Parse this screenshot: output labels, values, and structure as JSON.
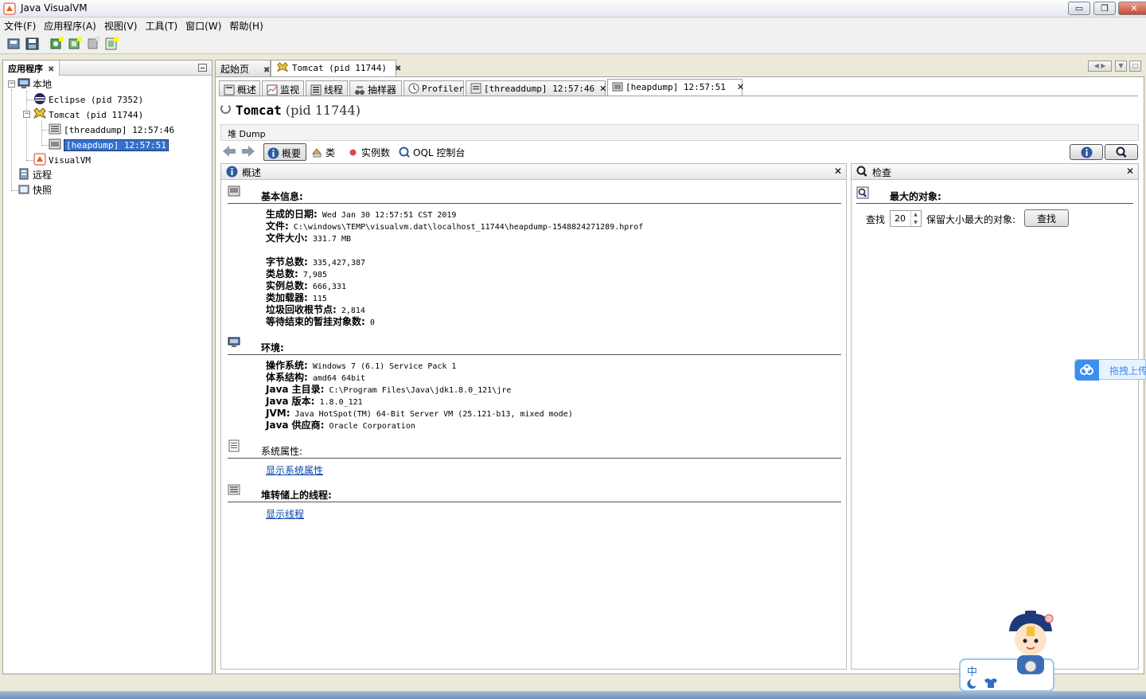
{
  "window": {
    "title": "Java VisualVM",
    "controls": {
      "minimize": "▭",
      "restore": "❐",
      "close": "✕"
    }
  },
  "menu": [
    "文件(F)",
    "应用程序(A)",
    "视图(V)",
    "工具(T)",
    "窗口(W)",
    "帮助(H)"
  ],
  "left_panel": {
    "tab_label": "应用程序",
    "tab_close": "✖",
    "tree": {
      "local": "本地",
      "eclipse": "Eclipse (pid 7352)",
      "tomcat": "Tomcat (pid 11744)",
      "threaddump": "[threaddump] 12:57:46",
      "heapdump": "[heapdump] 12:57:51",
      "visualvm": "VisualVM",
      "remote": "远程",
      "snapshot": "快照"
    }
  },
  "doc_tabs": {
    "start": "起始页",
    "tomcat": "Tomcat (pid 11744)",
    "close": "✖"
  },
  "sub_tabs": {
    "overview": "概述",
    "monitor": "监视",
    "threads": "线程",
    "sampler": "抽样器",
    "profiler": "Profiler",
    "threaddump": "[threaddump] 12:57:46",
    "heapdump": "[heapdump] 12:57:51",
    "close": "✕"
  },
  "page": {
    "title_name": "Tomcat",
    "title_pid": "(pid 11744)",
    "dump_label": "堆 Dump"
  },
  "view_toolbar": {
    "summary": "概要",
    "classes": "类",
    "instances": "实例数",
    "oql": "OQL 控制台"
  },
  "overview_panel": {
    "title": "概述",
    "close": "✕",
    "basic": {
      "title": "基本信息:",
      "rows": [
        {
          "k": "生成的日期:",
          "v": " Wed Jan 30 12:57:51 CST 2019"
        },
        {
          "k": "文件:",
          "v": " C:\\windows\\TEMP\\visualvm.dat\\localhost_11744\\heapdump-1548824271289.hprof"
        },
        {
          "k": "文件大小:",
          "v": " 331.7 MB"
        },
        {
          "k": "字节总数:",
          "v": " 335,427,387"
        },
        {
          "k": "类总数:",
          "v": " 7,985"
        },
        {
          "k": "实例总数:",
          "v": " 666,331"
        },
        {
          "k": "类加载器:",
          "v": " 115"
        },
        {
          "k": "垃圾回收根节点:",
          "v": " 2,814"
        },
        {
          "k": "等待结束的暂挂对象数:",
          "v": " 0"
        }
      ]
    },
    "env": {
      "title": "环境:",
      "rows": [
        {
          "k": "操作系统:",
          "v": " Windows 7 (6.1) Service Pack 1"
        },
        {
          "k": "体系结构:",
          "v": " amd64 64bit"
        },
        {
          "k": "Java 主目录:",
          "v": " C:\\Program Files\\Java\\jdk1.8.0_121\\jre"
        },
        {
          "k": "Java 版本:",
          "v": " 1.8.0_121"
        },
        {
          "k": "JVM:",
          "v": " Java HotSpot(TM) 64-Bit Server VM (25.121-b13, mixed mode)"
        },
        {
          "k": "Java 供应商:",
          "v": " Oracle Corporation"
        }
      ]
    },
    "sysprops": {
      "title": "系统属性:",
      "link": "显示系统属性"
    },
    "threads": {
      "title": "堆转储上的线程:",
      "link": "显示线程"
    }
  },
  "inspect_panel": {
    "title": "检查",
    "close": "✕",
    "section_title": "最大的对象:",
    "find_label": "查找",
    "count": "20",
    "suffix_label": "保留大小最大的对象:",
    "find_button": "查找"
  },
  "overlay": {
    "baidu_upload": "拖拽上传",
    "ime_label": "中"
  }
}
